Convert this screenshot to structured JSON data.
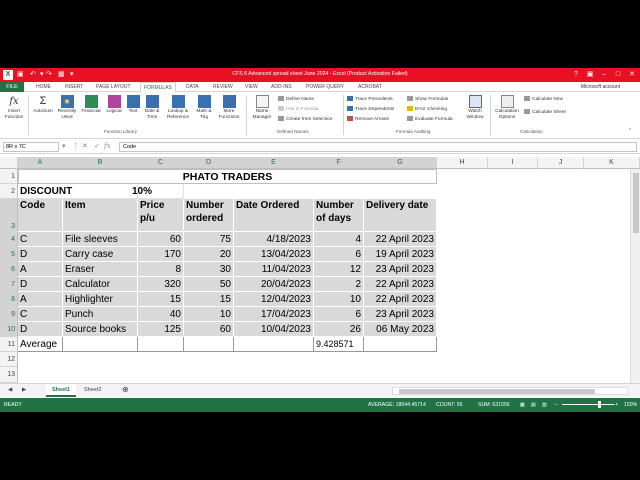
{
  "window": {
    "title": "CFS 6 Advanced spread sheet June 2024 - Excel (Product Activation Failed)",
    "account": "Microsoft account"
  },
  "tabs": [
    "FILE",
    "HOME",
    "INSERT",
    "PAGE LAYOUT",
    "FORMULAS",
    "DATA",
    "REVIEW",
    "VIEW",
    "ADD-INS",
    "POWER QUERY",
    "ACROBAT"
  ],
  "active_tab": "FORMULAS",
  "ribbon": {
    "insert_function": [
      "Insert",
      "Function"
    ],
    "autosum": [
      "AutoSum"
    ],
    "recently_used": [
      "Recently",
      "Used"
    ],
    "financial": [
      "Financial"
    ],
    "logical": [
      "Logical"
    ],
    "text": [
      "Text"
    ],
    "date_time": [
      "Date &",
      "Time"
    ],
    "lookup": [
      "Lookup &",
      "Reference"
    ],
    "math": [
      "Math &",
      "Trig"
    ],
    "more": [
      "More",
      "Functions"
    ],
    "name_manager": [
      "Name",
      "Manager"
    ],
    "define_name": "Define Name",
    "use_in_formula": "Use in Formula",
    "create_from_selection": "Create from Selection",
    "trace_precedents": "Trace Precedents",
    "trace_dependents": "Trace Dependents",
    "remove_arrows": "Remove Arrows",
    "show_formulas": "Show Formulas",
    "error_checking": "Error Checking",
    "evaluate_formula": "Evaluate Formula",
    "watch_window": [
      "Watch",
      "Window"
    ],
    "calc_options": [
      "Calculation",
      "Options"
    ],
    "calculate_now": "Calculate Now",
    "calculate_sheet": "Calculate Sheet",
    "groups": [
      "Function Library",
      "Defined Names",
      "Formula Auditing",
      "Calculation"
    ]
  },
  "formula_bar": {
    "name_box": "8R x 7C",
    "fx": "fx",
    "content": "Code"
  },
  "columns": [
    "A",
    "B",
    "C",
    "D",
    "E",
    "F",
    "G",
    "H",
    "I",
    "J",
    "K"
  ],
  "rows": [
    "1",
    "2",
    "3",
    "4",
    "5",
    "6",
    "7",
    "8",
    "9",
    "10",
    "11",
    "12",
    "13"
  ],
  "sheet": {
    "title": "PHATO TRADERS",
    "discount_label": "DISCOUNT",
    "discount_value": "10%",
    "headers": [
      "Code",
      "Item",
      "Price p/u",
      "Number ordered",
      "Date Ordered",
      "Number of days",
      "Delivery date"
    ],
    "data": [
      [
        "C",
        "File sleeves",
        "60",
        "75",
        "4/18/2023",
        "4",
        "22 April 2023"
      ],
      [
        "D",
        "Carry case",
        "170",
        "20",
        "13/04/2023",
        "6",
        "19 April 2023"
      ],
      [
        "A",
        "Eraser",
        "8",
        "30",
        "11/04/2023",
        "12",
        "23 April 2023"
      ],
      [
        "D",
        "Calculator",
        "320",
        "50",
        "20/04/2023",
        "2",
        "22 April 2023"
      ],
      [
        "A",
        "Highlighter",
        "15",
        "15",
        "12/04/2023",
        "10",
        "22 April 2023"
      ],
      [
        "C",
        "Punch",
        "40",
        "10",
        "17/04/2023",
        "6",
        "23 April 2023"
      ],
      [
        "D",
        "Source books",
        "125",
        "60",
        "10/04/2023",
        "26",
        "06 May 2023"
      ]
    ],
    "average_label": "Average",
    "average_value": "9.428571"
  },
  "sheet_tabs": [
    "Sheet1",
    "Sheet2"
  ],
  "status": {
    "mode": "READY",
    "average": "AVERAGE: 18044.45714",
    "count": "COUNT: 56",
    "sum": "SUM: 631556",
    "zoom": "150%"
  },
  "colors": {
    "excel_green": "#217346",
    "title_red": "#e81123",
    "cell_grey": "#d9d9d9"
  }
}
